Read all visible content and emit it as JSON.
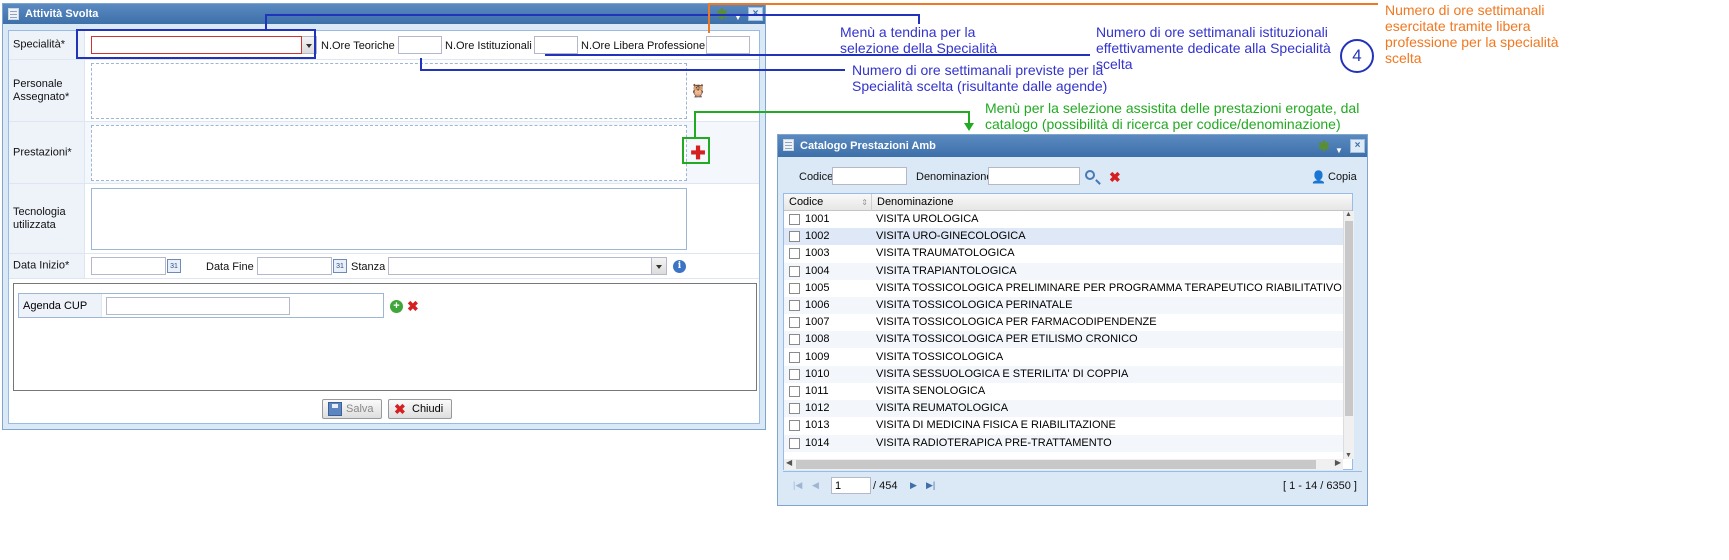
{
  "main_window": {
    "title": "Attività Svolta",
    "fields": {
      "specialita_label": "Specialità*",
      "ore_teoriche_label": "N.Ore Teoriche",
      "ore_istituzionali_label": "N.Ore Istituzionali",
      "ore_libera_label": "N.Ore Libera Professione",
      "personale_label": "Personale Assegnato*",
      "prestazioni_label": "Prestazioni*",
      "tecnologia_label": "Tecnologia utilizzata",
      "data_inizio_label": "Data Inizio*",
      "data_fine_label": "Data Fine",
      "stanza_label": "Stanza",
      "agenda_label": "Agenda CUP"
    },
    "buttons": {
      "save": "Salva",
      "close": "Chiudi"
    }
  },
  "catalog_window": {
    "title": "Catalogo Prestazioni Amb",
    "search": {
      "codice_label": "Codice",
      "denominazione_label": "Denominazione",
      "copy_label": "Copia"
    },
    "columns": [
      "Codice",
      "Denominazione"
    ],
    "rows": [
      {
        "code": "1001",
        "name": "VISITA UROLOGICA"
      },
      {
        "code": "1002",
        "name": "VISITA URO-GINECOLOGICA"
      },
      {
        "code": "1003",
        "name": "VISITA TRAUMATOLOGICA"
      },
      {
        "code": "1004",
        "name": "VISITA TRAPIANTOLOGICA"
      },
      {
        "code": "1005",
        "name": "VISITA TOSSICOLOGICA PRELIMINARE PER PROGRAMMA TERAPEUTICO RIABILITATIVO"
      },
      {
        "code": "1006",
        "name": "VISITA TOSSICOLOGICA PERINATALE"
      },
      {
        "code": "1007",
        "name": "VISITA TOSSICOLOGICA PER FARMACODIPENDENZE"
      },
      {
        "code": "1008",
        "name": "VISITA TOSSICOLOGICA PER ETILISMO CRONICO"
      },
      {
        "code": "1009",
        "name": "VISITA TOSSICOLOGICA"
      },
      {
        "code": "1010",
        "name": "VISITA SESSUOLOGICA E STERILITA' DI COPPIA"
      },
      {
        "code": "1011",
        "name": "VISITA SENOLOGICA"
      },
      {
        "code": "1012",
        "name": "VISITA REUMATOLOGICA"
      },
      {
        "code": "1013",
        "name": "VISITA DI MEDICINA FISICA E RIABILITAZIONE"
      },
      {
        "code": "1014",
        "name": "VISITA RADIOTERAPICA PRE-TRATTAMENTO"
      }
    ],
    "pager": {
      "page": "1",
      "total_pages": "/ 454",
      "range": "[ 1 - 14 / 6350 ]"
    }
  },
  "annotations": {
    "specialita": "Menù a tendina per la selezione della Specialità",
    "ore_istituzionali": "Numero di ore settimanali istituzionali effettivamente dedicate alla Specialità scelta",
    "ore_teoriche": "Numero di ore settimanali previste per la Specialità scelta (risultante dalle agende)",
    "prestazioni": "Menù per la selezione assistita delle prestazioni erogate, dal catalogo (possibilità di ricerca per codice/denominazione)",
    "libera": "Numero di ore settimanali esercitate tramite libera professione per la specialità scelta",
    "step_number": "4"
  },
  "colors": {
    "annotation_blue": "#3333cc",
    "annotation_green": "#22aa22",
    "annotation_orange": "#f07820",
    "window_header": "#3d6fa9"
  },
  "icons": [
    "window-icon",
    "gear-icon",
    "close-icon",
    "owl-icon",
    "add-red-icon",
    "calendar-icon",
    "info-icon",
    "add-green-icon",
    "delete-icon",
    "save-icon",
    "search-icon",
    "copy-icon"
  ]
}
